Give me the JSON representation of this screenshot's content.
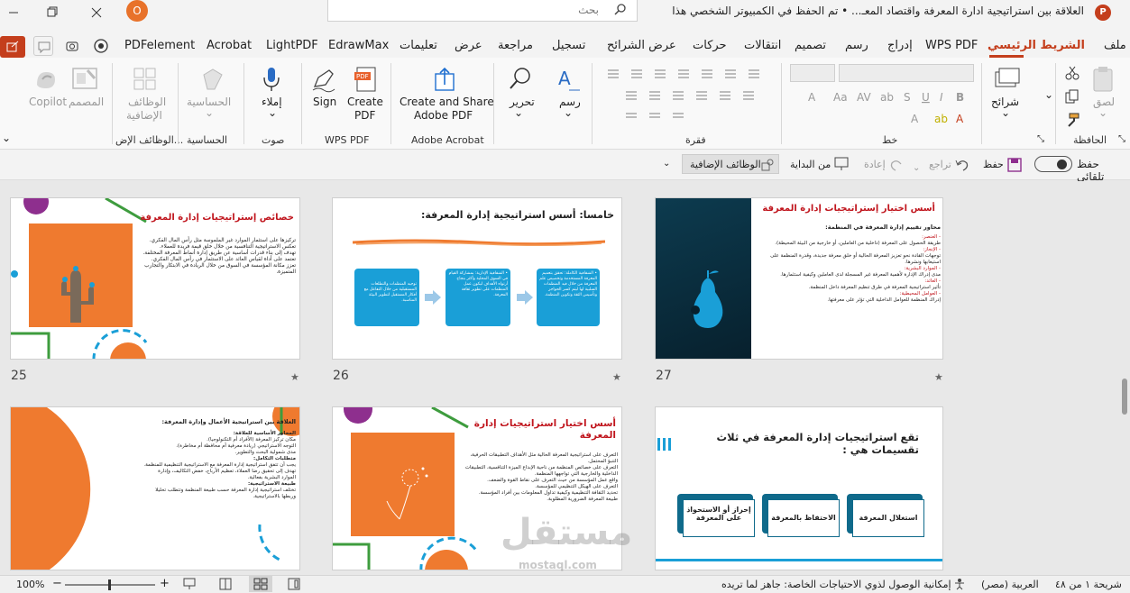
{
  "window": {
    "title": "العلاقة بين استراتيجية ادارة المعرفة واقتصاد المعـ... • تم الحفظ في الكمبيوتر الشخصي هذا",
    "search_placeholder": "بحث",
    "user_initial": "O",
    "brand_color": "#c43e1c"
  },
  "tabs": [
    {
      "label": "ملف"
    },
    {
      "label": "الشريط الرئيسي",
      "active": true
    },
    {
      "label": "WPS PDF"
    },
    {
      "label": "إدراج"
    },
    {
      "label": "رسم"
    },
    {
      "label": "تصميم"
    },
    {
      "label": "انتقالات"
    },
    {
      "label": "حركات"
    },
    {
      "label": "عرض الشرائح"
    },
    {
      "label": "تسجيل"
    },
    {
      "label": "مراجعة"
    },
    {
      "label": "عرض"
    },
    {
      "label": "تعليمات"
    },
    {
      "label": "EdrawMax"
    },
    {
      "label": "LightPDF"
    },
    {
      "label": "Acrobat"
    },
    {
      "label": "PDFelement"
    }
  ],
  "ribbon": {
    "groups": {
      "clipboard": "الحافظة",
      "slides": "شرائح",
      "font": "خط",
      "paragraph": "فقرة",
      "adobe": "Adobe Acrobat",
      "wps": "WPS PDF",
      "voice": "صوت",
      "sensitivity": "الحساسية",
      "addins": "الوظائف الإض..."
    },
    "buttons": {
      "paste": "لصق",
      "slides": "شرائح",
      "draw": "رسم",
      "edit": "تحرير",
      "create_share": "Create and Share",
      "create_share2": "Adobe PDF",
      "create_pdf": "Create",
      "create_pdf2": "PDF",
      "sign": "Sign",
      "dictate": "إملاء",
      "sensitivity": "الحساسية",
      "addins": "الوظائف",
      "addins2": "الإضافية",
      "designer": "المصمم",
      "copilot": "Copilot"
    }
  },
  "quick_access": {
    "autosave": "حفظ تلقائي",
    "save": "حفظ",
    "undo": "تراجع",
    "redo": "إعادة",
    "from_start": "من البداية",
    "addins": "الوظائف الإضافية"
  },
  "slides": [
    {
      "number": "27",
      "title": "أسس اختيار إستراتيجيات إدارة المعرفة",
      "subtitle": "محاور تقييم إدارة المعرفة في المنظمة:",
      "lines": [
        "- العنصر:",
        "طريقة الحصول على المعرفة (داخلية من العاملين، أو خارجية من البيئة المحيطة).",
        "- الإنجاز:",
        "توجهات القادة نحو تعزيز المعرفة الحالية أو خلق معرفة جديدة، وقدرة المنظمة على استيعابها ونشرها.",
        "- الموارد البشرية:",
        "مدى إدراك الإدارة لأهمية المعرفة غير المسجلة لدى العاملين وكيفية استثمارها.",
        "- العائد:",
        "تأثير استراتيجية المعرفة في طرق تنظيم المعرفة داخل المنظمة.",
        "- العوامل المحيطية:",
        "إدراك المنظمة للعوامل الداخلية التي تؤثر على معرفتها."
      ]
    },
    {
      "number": "26",
      "title": "خامسا: أسس استراتيجية إدارة المعرفة:",
      "boxes": [
        "• الشفافية الكاملة: تحقق بتعميم المعرفة المستخدمة وتخصيص علم المعرفة من خلال فيد المنظمات السلبية لها ليتم كسر الحواجز وتأسيس الثقة وتكوين المنظمة.",
        "• الشفافية الإدارية: بمشاركة القيام في السوق المحلية وأكثر بنجاح أرتواه الأهداف ليكون عمل المنظمات على تطوير ثقافة المعرفة.",
        "توجيه المنظمات والتطلعات المستقبلية من خلال التفاعل مع أفكار المستقبل لتطوير البيئة المناسبة."
      ]
    },
    {
      "number": "25",
      "title": "خصائص إستراتيجيات إدارة المعرفة",
      "bullets": [
        "تركيزها على استثمار الموارد غير الملموسة مثل رأس المال الفكري.",
        "تعكس الاستراتيجية التنافسية من خلال خلق قيمة فريدة للعملاء.",
        "تهدف إلى بناء قدرات أساسية عن طريق إدارة أنماط المعرفة المختلفة.",
        "تعتمد على أداة لقياس العائد على الاستثمار في رأس المال الفكري.",
        "تعزز مكانة المؤسسة في السوق من خلال الريادة في الابتكار والتجارب المتميزة."
      ]
    },
    {
      "number": "",
      "title": "تقع استراتيجيات إدارة المعرفة في ثلاث تقسيمات هي :",
      "boxes": [
        "استغلال المعرفة",
        "الاحتفاظ بالمعرفة",
        "إحراز أو الاستحواذ على المعرفة"
      ]
    },
    {
      "number": "",
      "title": "أسس اختيار استراتيجيات إدارة المعرفة",
      "bullets": [
        "التعرف على استراتيجية المعرفة الحالية مثل الأهداف التطبيقات الحرفية، التنبؤ المحتمل.",
        "التعرف على خصائص المنظمة من ناحية الإبداع الميزة التنافسية، التطبيقات الداخلية والخارجية التي تواجهها المنظمة.",
        "واقع عمل المؤسسة من حيث التعرف على نقاط القوة والضعف.",
        "التعرف على الهيكل التنظيمي للمؤسسة.",
        "تحديد الثقافة التنظيمية وكيفية تداول المعلومات بين أفراد المؤسسة.",
        "طبيعة المعرفة الضرورية المطلوبة."
      ]
    },
    {
      "number": "",
      "title": "العلاقة بين استراتيجية الأعمال وإدارة المعرفة:",
      "bullets": [
        "المحاور الأساسية للعلاقة:",
        "مكان تركيز المعرفة (الأفراد أم التكنولوجيا).",
        "التوجه الاستراتيجي (ريادة معرفية أم محافظة أم مخاطرة).",
        "مدى شمولية البحث والتطوير.",
        "متطلبات التكامل:",
        "يجب أن تتفق استراتيجية إدارة المعرفة مع الاستراتيجية التنظيمية للمنظمة.",
        "تهدف إلى تحقيق رضا العملاء، تعظيم الأرباح، خفض التكاليف، وإدارة الموارد البشرية بفعالية.",
        "طبيعة الاستراتيجية:",
        "تختلف استراتيجية إدارة المعرفة حسب طبيعة المنظمة وتتطلب تحليلا وربطها بالاستراتيجية."
      ]
    }
  ],
  "watermark": {
    "text": "مستقل",
    "sub": "mostaql.com"
  },
  "status": {
    "slide_info": "شريحة ١ من ٤٨",
    "language": "العربية (مصر)",
    "accessibility": "إمكانية الوصول لذوي الاحتياجات الخاصة: جاهز لما تريده",
    "zoom": "100%"
  },
  "colors": {
    "accent_blue": "#1a9fd7",
    "orange": "#ef7a2f",
    "green": "#3e9c3e",
    "purple": "#8e2f8e",
    "title_red": "#c0151d"
  }
}
